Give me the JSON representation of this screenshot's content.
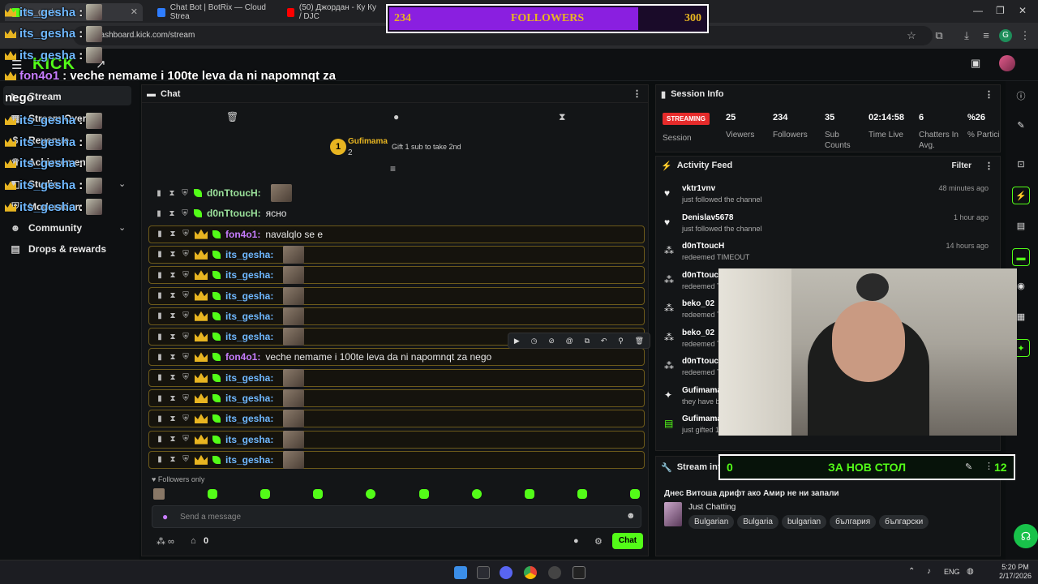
{
  "browser": {
    "tabs": [
      {
        "label": "Its_gesha"
      },
      {
        "label": "Chat Bot | BotRix — Cloud Strea"
      },
      {
        "label": "(50) Джордан - Ку Ку / DJC"
      }
    ],
    "url": "dashboard.kick.com/stream"
  },
  "overlay_followers": {
    "current": "234",
    "label": "FOLLOWERS",
    "goal": "300",
    "progress": 0.78
  },
  "overlay_goal2": {
    "current": "0",
    "label": "ЗА НОВ СТОЛ",
    "goal": "12"
  },
  "overlay_chat": [
    {
      "user": "its_gesha",
      "text": ":"
    },
    {
      "user": "its_gesha",
      "text": ":"
    },
    {
      "user": "its_gesha",
      "text": ":"
    },
    {
      "user": "fon4o1",
      "text": ": veche nemame i 100te leva da ni napomnqt za"
    },
    {
      "user": "",
      "text": "nego"
    },
    {
      "user": "its_gesha",
      "text": ":"
    },
    {
      "user": "its_gesha",
      "text": ":"
    },
    {
      "user": "its_gesha",
      "text": ":"
    },
    {
      "user": "its_gesha",
      "text": ":"
    },
    {
      "user": "its_gesha",
      "text": ":"
    }
  ],
  "logo": "KICK",
  "sidebar": {
    "items": [
      {
        "label": "Stream"
      },
      {
        "label": "Stream Overlay"
      },
      {
        "label": "Revenue"
      },
      {
        "label": "Achievements"
      },
      {
        "label": "Studio"
      },
      {
        "label": "Moderation"
      },
      {
        "label": "Community"
      },
      {
        "label": "Drops & rewards"
      }
    ]
  },
  "chat": {
    "title": "Chat",
    "pinned": {
      "rank": "1",
      "user": "Gufimama",
      "count": "2",
      "action": "Gift 1 sub to take 2nd"
    },
    "messages": [
      {
        "user": "d0nTtoucH:",
        "text": "",
        "color": "#9be29b",
        "emote": true,
        "hl": false
      },
      {
        "user": "d0nTtoucH:",
        "text": "ясно",
        "color": "#9be29b",
        "emote": false,
        "hl": false
      },
      {
        "user": "fon4o1:",
        "text": "navalqlo se e",
        "color": "#c77dff",
        "emote": false,
        "hl": true
      },
      {
        "user": "its_gesha:",
        "text": "",
        "color": "#6fb8ff",
        "emote": true,
        "hl": true
      },
      {
        "user": "its_gesha:",
        "text": "",
        "color": "#6fb8ff",
        "emote": true,
        "hl": true
      },
      {
        "user": "its_gesha:",
        "text": "",
        "color": "#6fb8ff",
        "emote": true,
        "hl": true
      },
      {
        "user": "its_gesha:",
        "text": "",
        "color": "#6fb8ff",
        "emote": true,
        "hl": true
      },
      {
        "user": "its_gesha:",
        "text": "",
        "color": "#6fb8ff",
        "emote": true,
        "hl": true
      },
      {
        "user": "fon4o1:",
        "text": "veche nemame i 100te leva da ni napomnqt za nego",
        "color": "#c77dff",
        "emote": false,
        "hl": true
      },
      {
        "user": "its_gesha:",
        "text": "",
        "color": "#6fb8ff",
        "emote": true,
        "hl": true
      },
      {
        "user": "its_gesha:",
        "text": "",
        "color": "#6fb8ff",
        "emote": true,
        "hl": true
      },
      {
        "user": "its_gesha:",
        "text": "",
        "color": "#6fb8ff",
        "emote": true,
        "hl": true
      },
      {
        "user": "its_gesha:",
        "text": "",
        "color": "#6fb8ff",
        "emote": true,
        "hl": true
      },
      {
        "user": "its_gesha:",
        "text": "",
        "color": "#6fb8ff",
        "emote": true,
        "hl": true
      }
    ],
    "followers_only": "Followers only",
    "input_placeholder": "Send a message",
    "points": "0",
    "send_label": "Chat"
  },
  "session": {
    "title": "Session Info",
    "status": "STREAMING",
    "status_label": "Session",
    "stats": [
      {
        "value": "25",
        "label": "Viewers"
      },
      {
        "value": "234",
        "label": "Followers"
      },
      {
        "value": "35",
        "label": "Sub Counts"
      },
      {
        "value": "02:14:58",
        "label": "Time Live"
      },
      {
        "value": "6",
        "label": "Chatters In Avg."
      },
      {
        "value": "%26",
        "label": "% Participa"
      }
    ]
  },
  "activity": {
    "title": "Activity Feed",
    "filter_label": "Filter",
    "items": [
      {
        "icon": "heart-icon",
        "name": "vktr1vnv",
        "sub": "just followed the channel",
        "time": "48 minutes ago"
      },
      {
        "icon": "heart-icon",
        "name": "Denislav5678",
        "sub": "just followed the channel",
        "time": "1 hour ago"
      },
      {
        "icon": "points-icon",
        "name": "d0nTtoucH",
        "sub": "redeemed TIMEOUT",
        "time": "14 hours ago"
      },
      {
        "icon": "points-icon",
        "name": "d0nTtoucH",
        "sub": "redeemed T",
        "time": ""
      },
      {
        "icon": "points-icon",
        "name": "beko_02",
        "sub": "redeemed T",
        "time": ""
      },
      {
        "icon": "points-icon",
        "name": "beko_02",
        "sub": "redeemed T",
        "time": ""
      },
      {
        "icon": "points-icon",
        "name": "d0nTtoucH",
        "sub": "redeemed T",
        "time": ""
      },
      {
        "icon": "sparkle-icon",
        "name": "Gufimama",
        "sub": "they have b",
        "time": ""
      },
      {
        "icon": "gift-icon",
        "name": "Gufimama",
        "sub": "just gifted 1",
        "time": ""
      }
    ]
  },
  "stream_info": {
    "title": "Stream info",
    "stream_title": "Днес Витоша дрифт ако Амир не ни запали",
    "category": "Just Chatting",
    "tags": [
      "Bulgarian",
      "Bulgaria",
      "bulgarian",
      "българия",
      "български"
    ]
  },
  "taskbar": {
    "lang": "ENG",
    "time": "5:20 PM",
    "date": "2/17/2026"
  },
  "colors": {
    "kick_green": "#53fc18",
    "followers_purple": "#8a1fe0",
    "crown_gold": "#e8b521"
  }
}
